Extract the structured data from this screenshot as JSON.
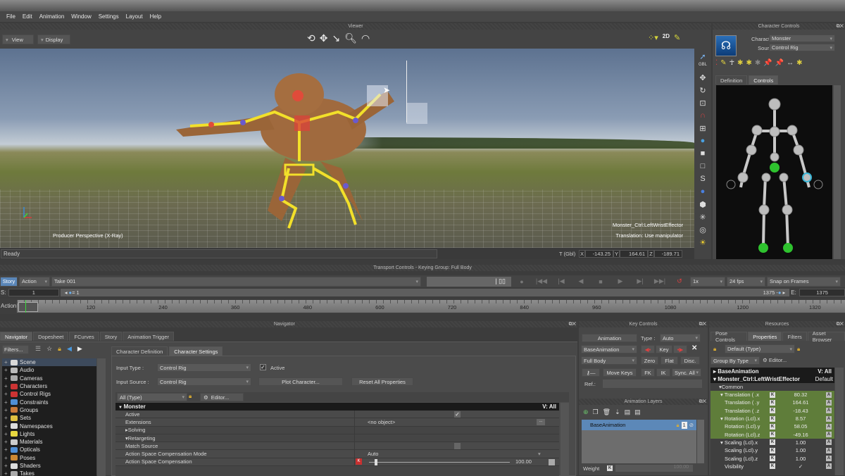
{
  "menu": [
    "File",
    "Edit",
    "Animation",
    "Window",
    "Settings",
    "Layout",
    "Help"
  ],
  "viewer": {
    "panel_title": "Viewer",
    "view_button": "View",
    "display_button": "Display",
    "tool_icons": [
      "orbit-icon",
      "pan-move-icon",
      "dolly-icon",
      "zoom-magnifier-icon",
      "roll-arc-icon"
    ],
    "right_tool_icons": [
      "trajectory-icon",
      "2d-view-icon",
      "pen-draw-icon"
    ],
    "camera_label": "Producer Perspective (X-Ray)",
    "selection_label": "Monster_Ctrl:LeftWristEffector",
    "manip_label": "Translation: Use manipulator",
    "side_tools": [
      "select-arrow-icon",
      "gbl-label",
      "translate-icon",
      "rotate-icon",
      "scale-icon",
      "magnet-icon",
      "pivot-icon",
      "globe-icon",
      "cube-icon",
      "cube2-icon",
      "path-icon",
      "bulb-icon",
      "hexagon-icon",
      "star-icon",
      "vr-icon",
      "sun-icon"
    ],
    "gbl_text": "GBL"
  },
  "status": {
    "text": "Ready",
    "coord_mode": "T (Gbl)",
    "x_label": "X",
    "x": "-143.25",
    "y_label": "Y",
    "y": "164.61",
    "z_label": "Z",
    "z": "-189.71"
  },
  "character_controls": {
    "title": "Character Controls",
    "character_label": "Character:",
    "character_value": "Monster",
    "source_label": "Source:",
    "source_value": "Control Rig",
    "tabs": [
      "Definition",
      "Controls"
    ],
    "active_tab": "Controls"
  },
  "transport": {
    "title": "Transport Controls  -  Keying Group: Full Body",
    "story_button": "Story",
    "action_dropdown": "Action",
    "take": "Take 001",
    "speed": "1x",
    "fps": "24 fps",
    "snap": "Snap on Frames",
    "start_label": "S:",
    "start_value": "1",
    "slider_start": "1",
    "slider_end": "1375",
    "end_label": "E:",
    "end_value": "1375",
    "action_label": "Action",
    "ruler_ticks": [
      "120",
      "240",
      "360",
      "480",
      "600",
      "720",
      "840",
      "960",
      "1080",
      "1200",
      "1320"
    ]
  },
  "navigator": {
    "panel_title": "Navigator",
    "tabs": [
      "Navigator",
      "Dopesheet",
      "FCurves",
      "Story",
      "Animation Trigger"
    ],
    "filters_button": "Filters...",
    "tree": [
      {
        "label": "Scene",
        "color": "#d9d9d9",
        "selected": true
      },
      {
        "label": "Audio",
        "color": "#bbbbbb"
      },
      {
        "label": "Cameras",
        "color": "#aaaaaa"
      },
      {
        "label": "Characters",
        "color": "#cc3333"
      },
      {
        "label": "Control Rigs",
        "color": "#cc3333"
      },
      {
        "label": "Constraints",
        "color": "#4f8fd6"
      },
      {
        "label": "Groups",
        "color": "#c97a3a"
      },
      {
        "label": "Sets",
        "color": "#e0c040"
      },
      {
        "label": "Namespaces",
        "color": "#dddddd"
      },
      {
        "label": "Lights",
        "color": "#e8d840"
      },
      {
        "label": "Materials",
        "color": "#cccccc"
      },
      {
        "label": "Opticals",
        "color": "#4f8fd6"
      },
      {
        "label": "Poses",
        "color": "#cc8833"
      },
      {
        "label": "Shaders",
        "color": "#dddddd"
      },
      {
        "label": "Takes",
        "color": "#aaaaaa"
      }
    ],
    "sub_tabs": [
      "Character Definition",
      "Character Settings"
    ],
    "active_sub_tab": "Character Settings",
    "input_type_label": "Input Type :",
    "input_type_value": "Control Rig",
    "active_checkbox_label": "Active",
    "input_source_label": "Input Source :",
    "input_source_value": "Control Rig",
    "plot_button": "Plot Character...",
    "reset_button": "Reset All Properties",
    "type_filter": "All (Type)",
    "editor_button": "Editor...",
    "group_header": "Monster",
    "group_view": "V: All",
    "properties": [
      {
        "label": "Active",
        "value": "✓",
        "kind": "check"
      },
      {
        "label": "Extensions",
        "value": "<no object>",
        "kind": "object"
      },
      {
        "label": "Solving",
        "value": "",
        "kind": "collapsed"
      },
      {
        "label": "Retargeting",
        "value": "",
        "kind": "expanded"
      },
      {
        "label": "Match Source",
        "value": "",
        "kind": "check-off"
      },
      {
        "label": "Action Space Compensation Mode",
        "value": "Auto",
        "kind": "dropdown"
      },
      {
        "label": "Action Space Compensation",
        "value": "100.00",
        "kind": "slider",
        "fraction": 0.05
      }
    ]
  },
  "key_controls": {
    "title": "Key Controls",
    "animation_button": "Animation",
    "type_label": "Type :",
    "type_value": "Auto",
    "layer_value": "BaseAnimation",
    "key_button": "Key",
    "body_value": "Full Body",
    "zero_button": "Zero",
    "flat_button": "Flat",
    "disc_button": "Disc.",
    "move_keys_button": "Move Keys",
    "fk_button": "FK",
    "ik_button": "IK",
    "sync_button": "Sync. All",
    "ref_label": "Ref.:"
  },
  "animation_layers": {
    "title": "Animation Layers",
    "layers": [
      "BaseAnimation"
    ],
    "weight_label": "Weight",
    "weight_value": "100.00"
  },
  "resources": {
    "title": "Resources",
    "tabs": [
      "Pose Controls",
      "Properties",
      "Filters",
      "Asset Browser"
    ],
    "active_tab": "Properties",
    "filter_value": "Default (Type)",
    "group_by": "Group By Type",
    "editor_button": "Editor...",
    "base_animation": "BaseAnimation",
    "base_view": "V: All",
    "object_name": "Monster_Ctrl:LeftWristEffector",
    "object_default": "Default",
    "common_label": "Common",
    "rows": [
      {
        "label": "Translation ( .x",
        "value": "80.32",
        "green": true,
        "expander": true
      },
      {
        "label": "Translation ( .y",
        "value": "164.61",
        "green": true
      },
      {
        "label": "Translation ( .z",
        "value": "-18.43",
        "green": true
      },
      {
        "label": "Rotation (Lcl).x",
        "value": "8.57",
        "green": true,
        "expander": true
      },
      {
        "label": "Rotation (Lcl).y",
        "value": "58.05",
        "green": true
      },
      {
        "label": "Rotation (Lcl).z",
        "value": "-49.16",
        "green": true
      },
      {
        "label": "Scaling (Lcl).x",
        "value": "1.00",
        "green": false,
        "expander": true
      },
      {
        "label": "Scaling (Lcl).y",
        "value": "1.00",
        "green": false
      },
      {
        "label": "Scaling (Lcl).z",
        "value": "1.00",
        "green": false
      },
      {
        "label": "Visibility",
        "value": "✓",
        "green": false
      }
    ]
  }
}
